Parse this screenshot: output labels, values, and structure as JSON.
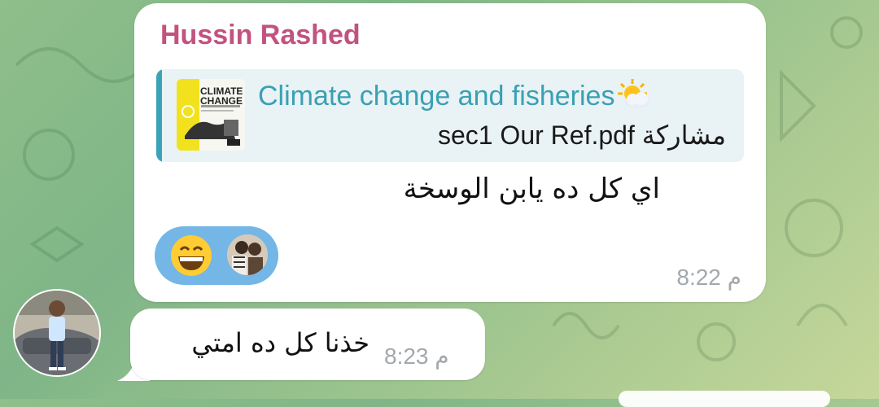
{
  "chat": {
    "messages": [
      {
        "sender": "Hussin Rashed",
        "reply": {
          "title": "Climate change and fisheries",
          "subtitle": "sec1 Our Ref.pdf مشاركة",
          "thumb_title": "CLIMATE CHANGE",
          "thumb_icon": "document-cover-icon"
        },
        "text": "اي كل ده يابن الوسخة",
        "reactions": [
          {
            "type": "emoji",
            "icon": "grinning-face-icon"
          },
          {
            "type": "avatar",
            "icon": "reactor-avatar"
          }
        ],
        "time": "8:22 م"
      },
      {
        "text": "خذنا كل ده امتي",
        "time": "8:23 م"
      }
    ]
  },
  "colors": {
    "sender_name": "#c2527f",
    "reply_accent": "#3aa3b7",
    "reaction_bg": "#74b6e6",
    "bubble": "#ffffff",
    "time": "#a3a8ad"
  }
}
